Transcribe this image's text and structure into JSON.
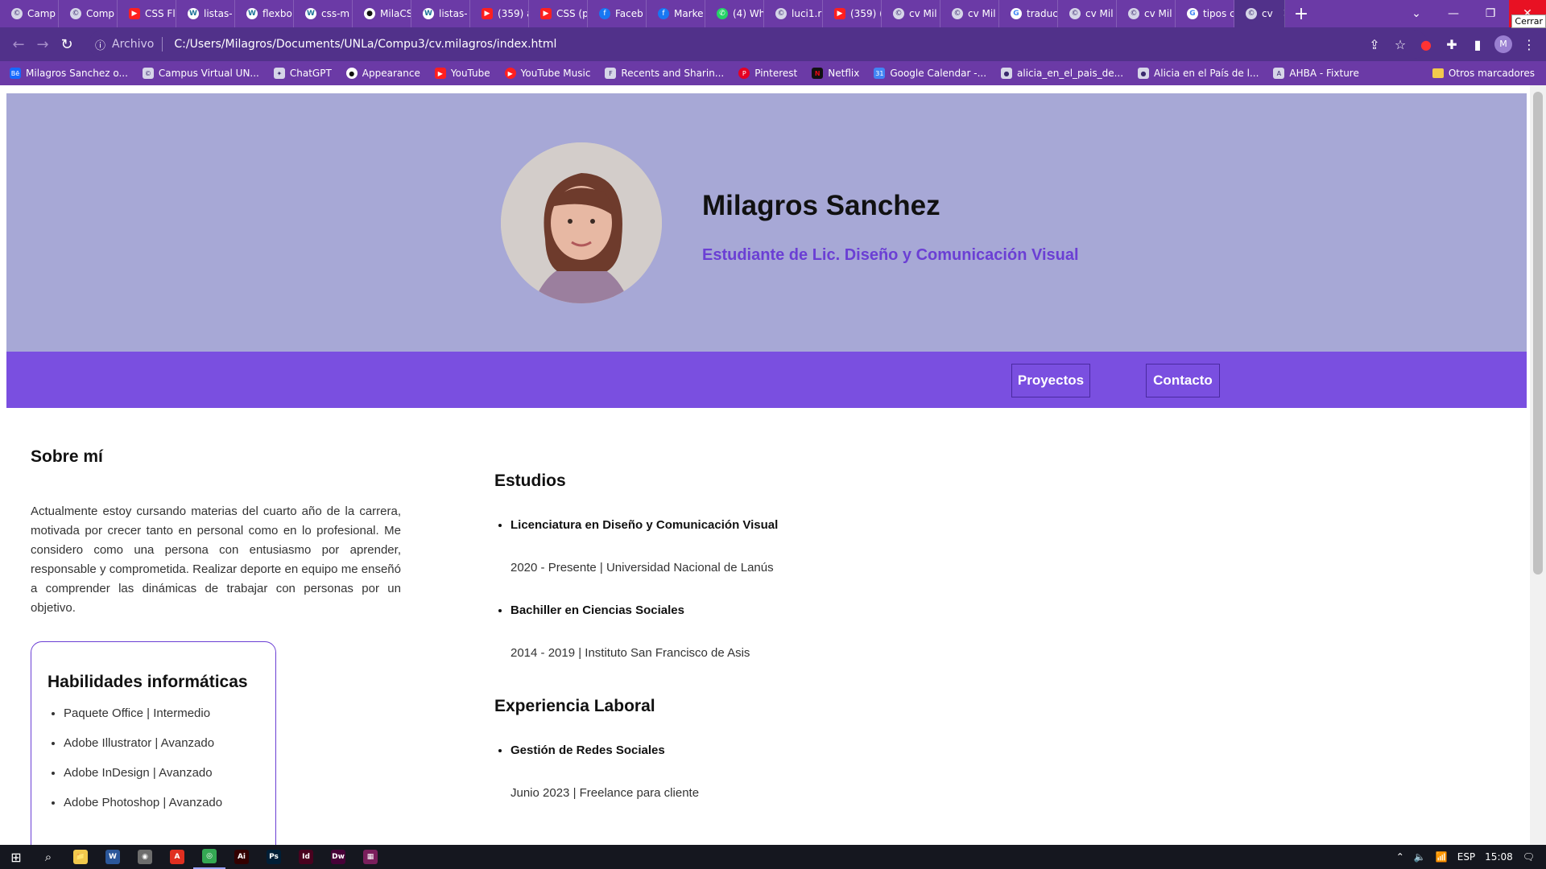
{
  "browser": {
    "tabs": [
      {
        "label": "Camp",
        "icon": "site"
      },
      {
        "label": "Comp",
        "icon": "site"
      },
      {
        "label": "CSS Fl",
        "icon": "yt"
      },
      {
        "label": "listas-",
        "icon": "wp"
      },
      {
        "label": "flexbo",
        "icon": "wp"
      },
      {
        "label": "css-m",
        "icon": "wp"
      },
      {
        "label": "MilaCS",
        "icon": "gh"
      },
      {
        "label": "listas-",
        "icon": "wp"
      },
      {
        "label": "(359) a",
        "icon": "yt"
      },
      {
        "label": "CSS (p",
        "icon": "yt"
      },
      {
        "label": "Faceb",
        "icon": "fb"
      },
      {
        "label": "Marke",
        "icon": "fb"
      },
      {
        "label": "(4) Wh",
        "icon": "wa"
      },
      {
        "label": "luci1.r",
        "icon": "site"
      },
      {
        "label": "(359) (",
        "icon": "yt"
      },
      {
        "label": "cv Mil",
        "icon": "site"
      },
      {
        "label": "cv Mil",
        "icon": "site"
      },
      {
        "label": "traduc",
        "icon": "gg"
      },
      {
        "label": "cv Mil",
        "icon": "site"
      },
      {
        "label": "cv Mil",
        "icon": "site"
      },
      {
        "label": "tipos c",
        "icon": "gg"
      },
      {
        "label": "cv",
        "icon": "site",
        "active": true
      }
    ],
    "close_tooltip": "Cerrar",
    "address_prefix": "Archivo",
    "address_url": "C:/Users/Milagros/Documents/UNLa/Compu3/cv.milagros/index.html",
    "profile_initial": "M",
    "bookmarks": [
      {
        "label": "Milagros Sanchez o...",
        "icon": "be",
        "glyph": "Bē"
      },
      {
        "label": "Campus Virtual UN...",
        "icon": "site",
        "glyph": "©"
      },
      {
        "label": "ChatGPT",
        "icon": "site",
        "glyph": "✦"
      },
      {
        "label": "Appearance",
        "icon": "gh",
        "glyph": "●"
      },
      {
        "label": "YouTube",
        "icon": "yt",
        "glyph": "▶"
      },
      {
        "label": "YouTube Music",
        "icon": "ytm",
        "glyph": "▶"
      },
      {
        "label": "Recents and Sharin...",
        "icon": "site",
        "glyph": "F"
      },
      {
        "label": "Pinterest",
        "icon": "pin",
        "glyph": "P"
      },
      {
        "label": "Netflix",
        "icon": "nf",
        "glyph": "N"
      },
      {
        "label": "Google Calendar -...",
        "icon": "cal",
        "glyph": "31"
      },
      {
        "label": "alicia_en_el_pais_de...",
        "icon": "site",
        "glyph": "●"
      },
      {
        "label": "Alicia en el País de l...",
        "icon": "site",
        "glyph": "●"
      },
      {
        "label": "AHBA - Fixture",
        "icon": "site",
        "glyph": "A"
      }
    ],
    "other_bookmarks": "Otros marcadores"
  },
  "cv": {
    "name": "Milagros Sanchez",
    "subtitle": "Estudiante de Lic. Diseño y Comunicación Visual",
    "nav": {
      "projects": "Proyectos",
      "contact": "Contacto"
    },
    "about_title": "Sobre mí",
    "about_text": "Actualmente estoy cursando materias del cuarto año de la carrera, motivada por crecer tanto en personal como en lo profesional. Me considero como una persona con entusiasmo por aprender, responsable y comprometida. Realizar deporte en equipo me enseñó a comprender las dinámicas de trabajar con personas por un objetivo.",
    "skills_title": "Habilidades informáticas",
    "skills": [
      "Paquete Office | Intermedio",
      "Adobe Illustrator | Avanzado",
      "Adobe InDesign | Avanzado",
      "Adobe Photoshop | Avanzado"
    ],
    "studies_title": "Estudios",
    "studies": [
      {
        "title": "Licenciatura en Diseño y Comunicación Visual",
        "meta": "2020 - Presente | Universidad Nacional de Lanús"
      },
      {
        "title": "Bachiller en Ciencias Sociales",
        "meta": "2014 - 2019 | Instituto San Francisco de Asis"
      }
    ],
    "work_title": "Experiencia Laboral",
    "work": [
      {
        "title": "Gestión de Redes Sociales",
        "meta": "Junio 2023 | Freelance para cliente"
      }
    ]
  },
  "taskbar": {
    "apps": [
      {
        "name": "file-explorer-icon",
        "glyph": "📁",
        "color": "#f2c94c"
      },
      {
        "name": "word-icon",
        "glyph": "W",
        "color": "#2b579a"
      },
      {
        "name": "app-icon",
        "glyph": "◉",
        "color": "#6d6d6d"
      },
      {
        "name": "acrobat-icon",
        "glyph": "A",
        "color": "#e02f20"
      },
      {
        "name": "chrome-icon",
        "glyph": "◎",
        "color": "#34a853",
        "open": true
      },
      {
        "name": "illustrator-icon",
        "glyph": "Ai",
        "color": "#330000"
      },
      {
        "name": "photoshop-icon",
        "glyph": "Ps",
        "color": "#001e36"
      },
      {
        "name": "indesign-icon",
        "glyph": "Id",
        "color": "#49021f"
      },
      {
        "name": "dreamweaver-icon",
        "glyph": "Dw",
        "color": "#470137"
      },
      {
        "name": "winrar-icon",
        "glyph": "▦",
        "color": "#7a1f5c"
      }
    ],
    "language": "ESP",
    "time": "15:08"
  },
  "colors": {
    "chrome_tabbar": "#6b3aa6",
    "chrome_toolbar": "#51318a",
    "hero_bg": "#a7a8d6",
    "nav_band": "#7a4fe0",
    "accent_text": "#6b3fd4"
  }
}
